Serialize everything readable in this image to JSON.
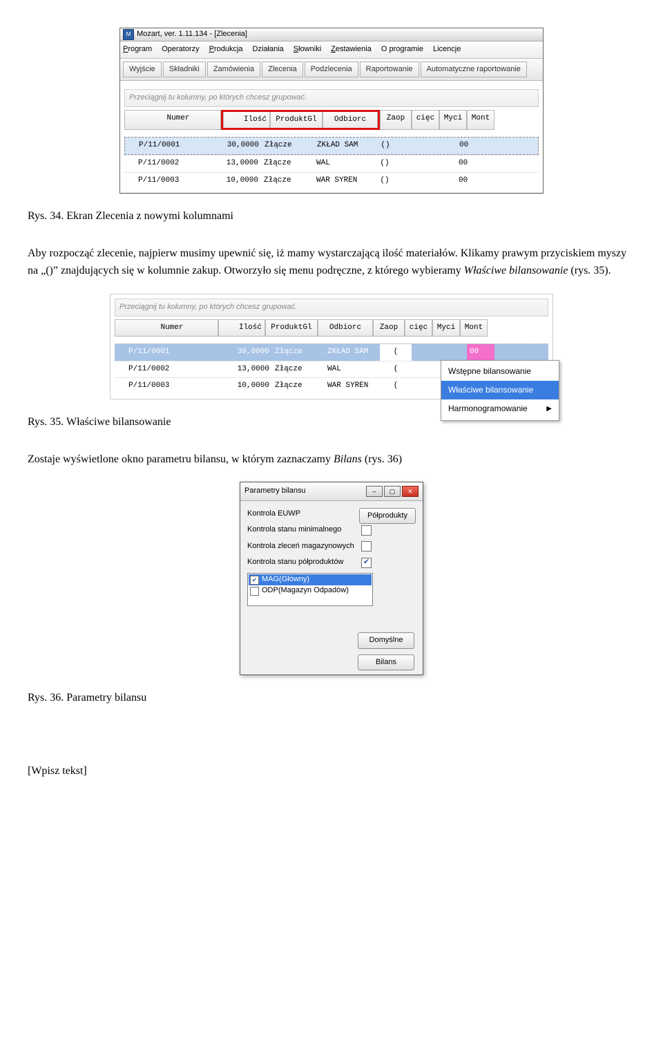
{
  "screenshot1": {
    "window_title": "Mozart, ver. 1.11.134 - [Zlecenia]",
    "menu": [
      "Program",
      "Operatorzy",
      "Produkcja",
      "Działania",
      "Słowniki",
      "Zestawienia",
      "O programie",
      "Licencje"
    ],
    "toolbar": [
      "Wyjście",
      "Składniki",
      "Zamówienia",
      "Zlecenia",
      "Podzlecenia",
      "Raportowanie",
      "Automatyczne raportowanie"
    ],
    "group_hint": "Przeciągnij tu kolumny, po których chcesz grupować.",
    "columns": [
      "Numer",
      "Ilość",
      "ProduktGl",
      "Odbiorc",
      "Zaop",
      "cięc",
      "Myci",
      "Mont"
    ],
    "rows": [
      {
        "numer": "P/11/0001",
        "ilosc": "30,0000",
        "produkt": "Złącze",
        "odbiorc": "ZKŁAD SAM",
        "zaop": "()",
        "ciec": "",
        "myci": "",
        "mont": "00"
      },
      {
        "numer": "P/11/0002",
        "ilosc": "13,0000",
        "produkt": "Złącze",
        "odbiorc": "WAL",
        "zaop": "()",
        "ciec": "",
        "myci": "",
        "mont": "00"
      },
      {
        "numer": "P/11/0003",
        "ilosc": "10,0000",
        "produkt": "Złącze",
        "odbiorc": "WAR SYREN",
        "zaop": "()",
        "ciec": "",
        "myci": "",
        "mont": "00"
      }
    ]
  },
  "caption1": "Rys. 34. Ekran Zlecenia z nowymi kolumnami",
  "para1a": "Aby rozpocząć zlecenie, najpierw musimy upewnić się, iż mamy wystarczającą ilość materiałów. Klikamy prawym przyciskiem myszy na „()” znajdujących się w kolumnie zakup. Otworzyło się menu podręczne, z którego wybieramy ",
  "para1b": "Właściwe bilansowanie",
  "para1c": " (rys. 35).",
  "screenshot2": {
    "group_hint": "Przeciągnij tu kolumny, po których chcesz grupować.",
    "columns": [
      "Numer",
      "Ilość",
      "ProduktGl",
      "Odbiorc",
      "Zaop",
      "cięc",
      "Myci",
      "Mont"
    ],
    "rows": [
      {
        "numer": "P/11/0001",
        "ilosc": "30,0000",
        "produkt": "Złącze",
        "odbiorc": "ZKŁAD SAM",
        "zaop": "(",
        "mont": "00"
      },
      {
        "numer": "P/11/0002",
        "ilosc": "13,0000",
        "produkt": "Złącze",
        "odbiorc": "WAL",
        "zaop": "(",
        "mont": ""
      },
      {
        "numer": "P/11/0003",
        "ilosc": "10,0000",
        "produkt": "Złącze",
        "odbiorc": "WAR SYREN",
        "zaop": "(",
        "mont": ""
      }
    ],
    "context_menu": [
      "Wstępne bilansowanie",
      "Właściwe bilansowanie",
      "Harmonogramowanie"
    ]
  },
  "caption2": "Rys. 35. Właściwe bilansowanie",
  "para2a": "Zostaje wyświetlone okno parametru bilansu, w którym zaznaczamy ",
  "para2b": "Bilans",
  "para2c": " (rys. 36)",
  "dialog": {
    "title": "Parametry bilansu",
    "fields": [
      {
        "label": "Kontrola EUWP",
        "checked": false
      },
      {
        "label": "Kontrola stanu minimalnego",
        "checked": false
      },
      {
        "label": "Kontrola zleceń magazynowych",
        "checked": false
      },
      {
        "label": "Kontrola stanu półproduktów",
        "checked": true
      }
    ],
    "side_button": "Półprodukty",
    "list": [
      {
        "label": "MAG(Główny)",
        "checked": true,
        "selected": true
      },
      {
        "label": "ODP(Magazyn Odpadów)",
        "checked": false,
        "selected": false
      }
    ],
    "buttons": [
      "Domyślne",
      "Bilans"
    ]
  },
  "caption3": "Rys. 36. Parametry bilansu",
  "footer": "[Wpisz tekst]"
}
